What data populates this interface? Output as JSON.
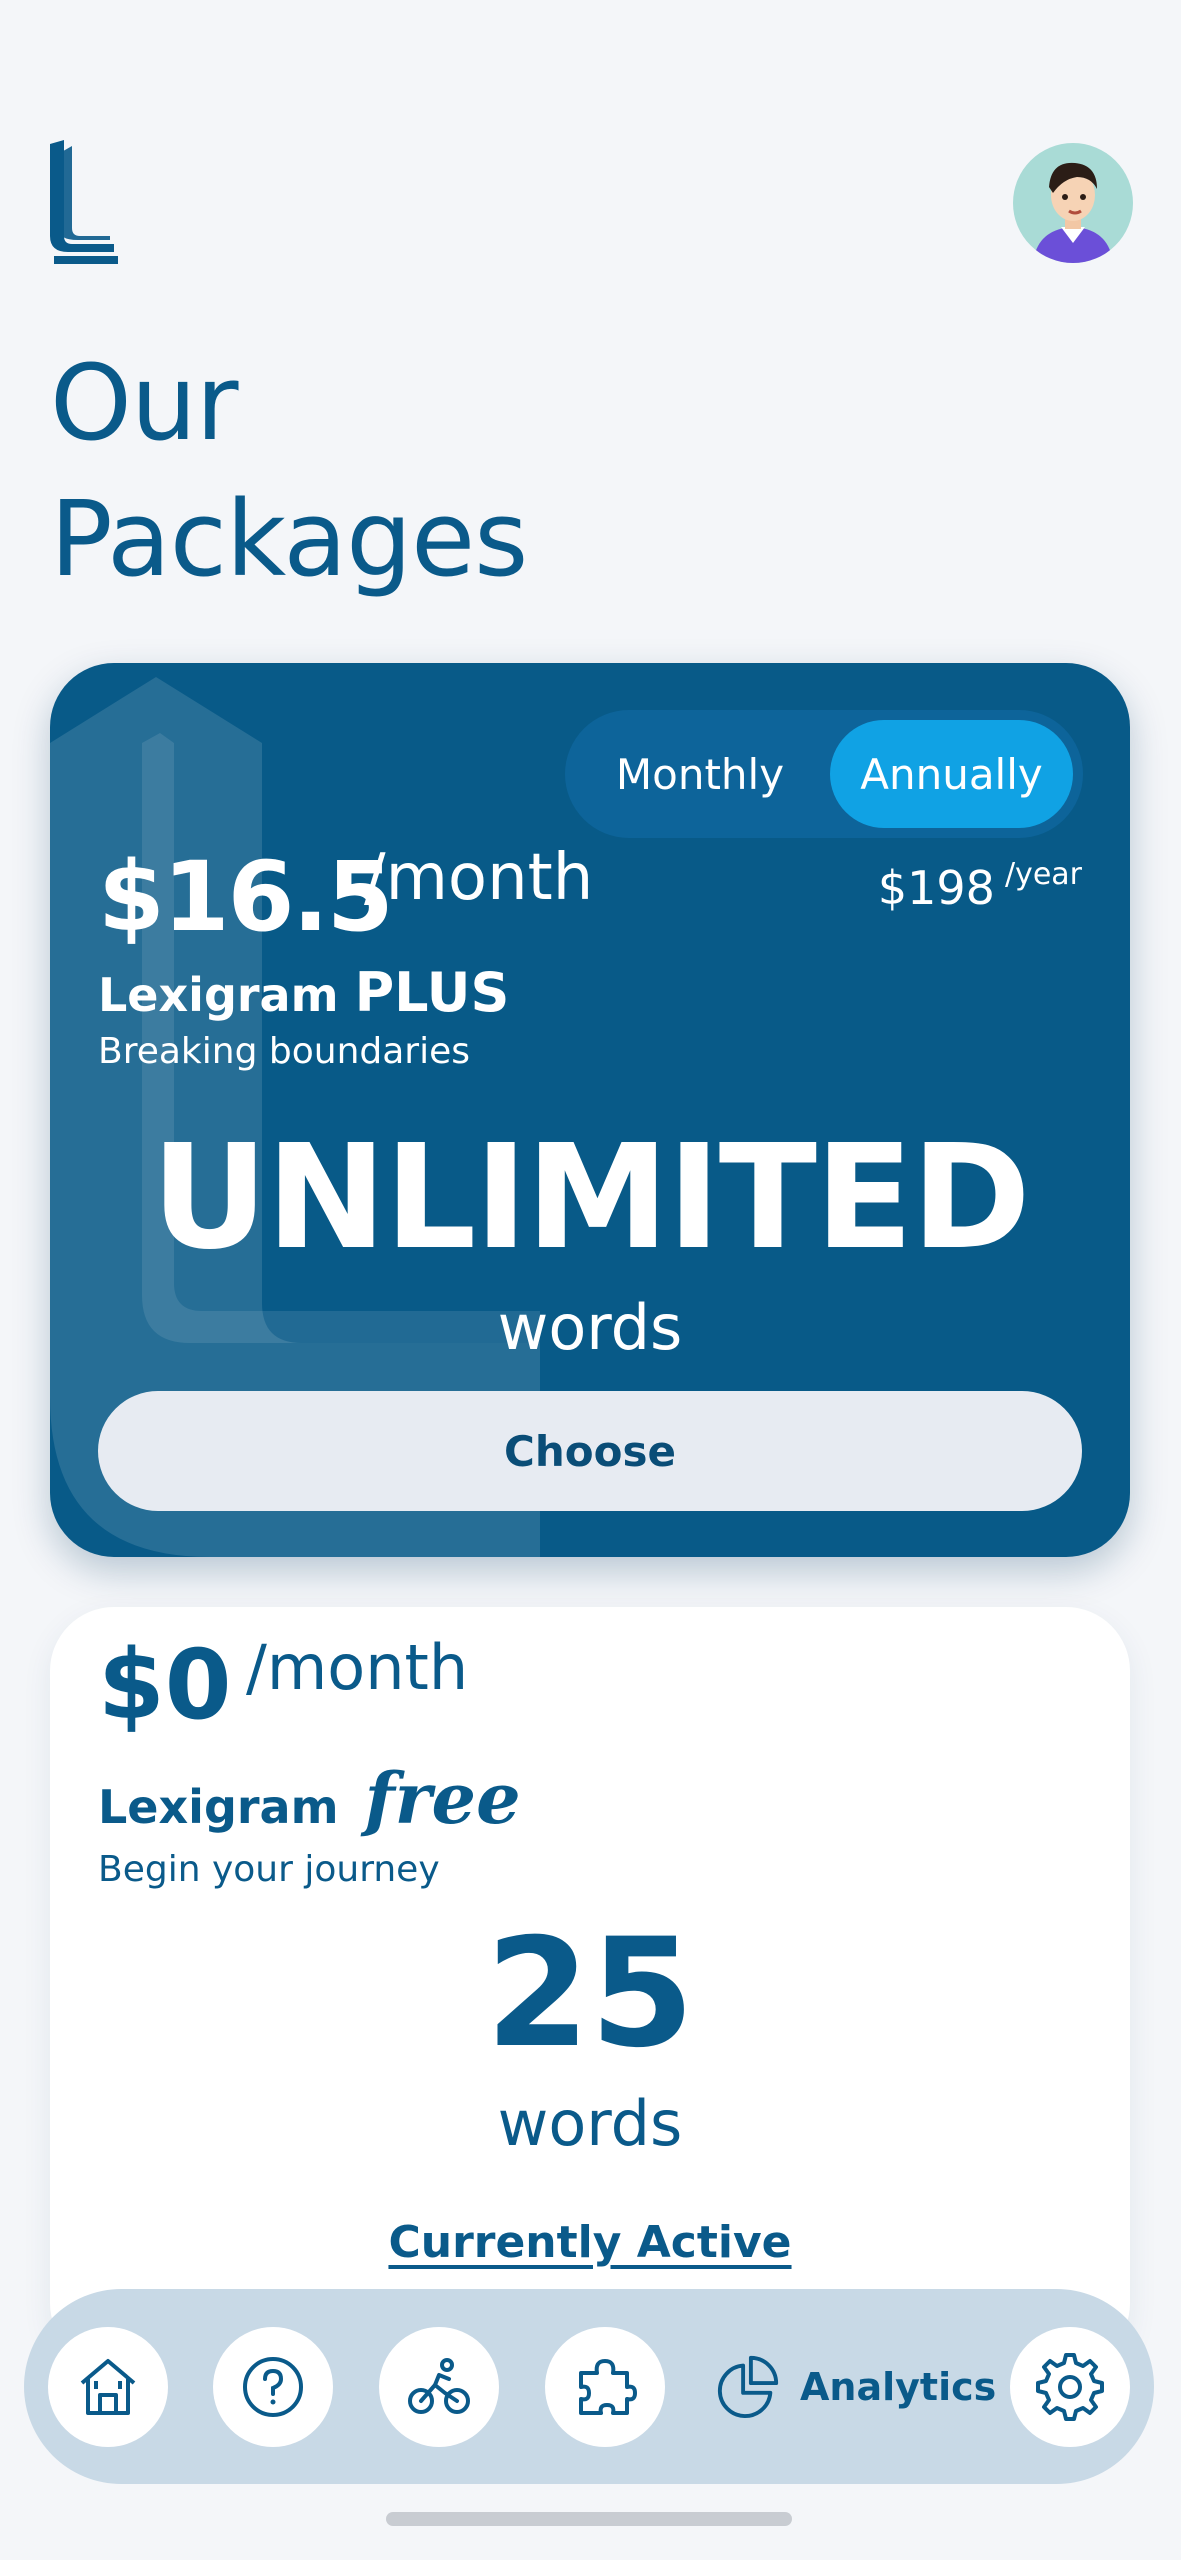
{
  "page": {
    "title_line1": "Our",
    "title_line2": "Packages"
  },
  "icons": {
    "logo": "lexigram-logo",
    "avatar": "user-avatar",
    "home": "home-icon",
    "help": "help-icon",
    "activity": "bicycle-icon",
    "extensions": "puzzle-icon",
    "analytics": "pie-chart-icon",
    "settings": "gear-icon"
  },
  "billing_toggle": {
    "monthly": "Monthly",
    "annually": "Annually",
    "selected": "Annually"
  },
  "plus_plan": {
    "price": "$16.5",
    "period": "/month",
    "yearly_price": "$198",
    "yearly_period": "/year",
    "brand": "Lexigram",
    "tier": "PLUS",
    "tagline": "Breaking boundaries",
    "limit": "UNLIMITED",
    "unit": "words",
    "cta": "Choose"
  },
  "free_plan": {
    "price": "$0",
    "period": "/month",
    "brand": "Lexigram",
    "tier": "free",
    "tagline": "Begin your journey",
    "limit": "25",
    "unit": "words",
    "status": "Currently Active"
  },
  "nav": {
    "analytics_label": "Analytics",
    "active": "Analytics"
  },
  "colors": {
    "primary": "#085a88",
    "accent": "#10a2e4",
    "background": "#f4f6f9",
    "nav_bg": "#c8d9e6"
  }
}
